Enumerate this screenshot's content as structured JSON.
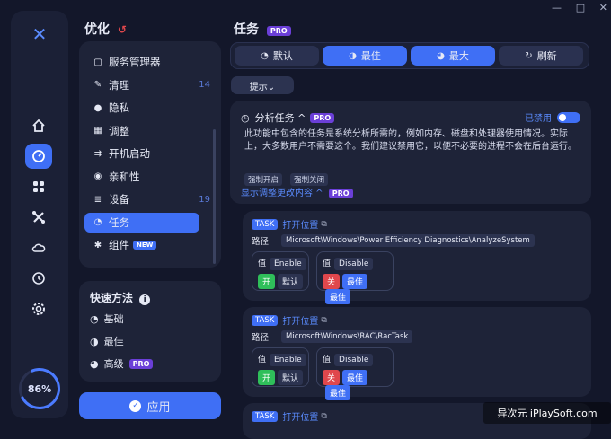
{
  "window_controls": {
    "min": "—",
    "max": "□",
    "close": "✕"
  },
  "section_title": "优化",
  "section_icon": "↺",
  "menu": [
    {
      "label": "服务管理器",
      "icon": "window-icon",
      "glyph": "▢",
      "count": ""
    },
    {
      "label": "清理",
      "icon": "broom-icon",
      "glyph": "✎",
      "count": "14"
    },
    {
      "label": "隐私",
      "icon": "privacy-icon",
      "glyph": "●",
      "count": ""
    },
    {
      "label": "调整",
      "icon": "grid-icon",
      "glyph": "▦",
      "count": ""
    },
    {
      "label": "开机启动",
      "icon": "startup-icon",
      "glyph": "⇉",
      "count": ""
    },
    {
      "label": "亲和性",
      "icon": "affinity-icon",
      "glyph": "◉",
      "count": ""
    },
    {
      "label": "设备",
      "icon": "device-icon",
      "glyph": "≣",
      "count": "19"
    },
    {
      "label": "任务",
      "icon": "task-icon",
      "glyph": "◔",
      "count": ""
    },
    {
      "label": "组件",
      "icon": "component-icon",
      "glyph": "✱",
      "count": "",
      "badge": "NEW"
    }
  ],
  "quick": {
    "title": "快速方法",
    "info": "i",
    "items": [
      {
        "label": "基础",
        "glyph": "◔"
      },
      {
        "label": "最佳",
        "glyph": "◑"
      },
      {
        "label": "高级",
        "glyph": "◕",
        "badge": "PRO"
      }
    ]
  },
  "apply_label": "应用",
  "main_title": "任务",
  "main_badge": "PRO",
  "modes": [
    {
      "label": "默认",
      "glyph": "◔",
      "active": false
    },
    {
      "label": "最佳",
      "glyph": "◑",
      "active": true
    },
    {
      "label": "最大",
      "glyph": "◕",
      "active": true
    },
    {
      "label": "刷新",
      "glyph": "↻",
      "active": false
    }
  ],
  "hint_button": "提示⌄",
  "info_card": {
    "title": "分析任务 ^",
    "badge": "PRO",
    "status": "已禁用",
    "desc": "此功能中包含的任务是系统分析所需的，例如内存、磁盘和处理器使用情况。实际上，大多数用户不需要这个。我们建议禁用它，以便不必要的进程不会在后台运行。",
    "tag1": "强制开启",
    "tag2": "强制关闭",
    "link": "显示调整更改内容 ^",
    "link_badge": "PRO"
  },
  "tasks": [
    {
      "tag": "TASK",
      "open": "打开位置",
      "path_label": "路径",
      "path": "Microsoft\\Windows\\Power Efficiency Diagnostics\\AnalyzeSystem",
      "val_label": "值",
      "v1": "Enable",
      "on": "开",
      "def": "默认",
      "v2": "Disable",
      "off": "关",
      "best1": "最佳",
      "best2": "最佳"
    },
    {
      "tag": "TASK",
      "open": "打开位置",
      "path_label": "路径",
      "path": "Microsoft\\Windows\\RAC\\RacTask",
      "val_label": "值",
      "v1": "Enable",
      "on": "开",
      "def": "默认",
      "v2": "Disable",
      "off": "关",
      "best1": "最佳",
      "best2": "最佳"
    },
    {
      "tag": "TASK",
      "open": "打开位置"
    }
  ],
  "gauge_text": "86%",
  "watermark": "异次元 iPlaySoft.com"
}
